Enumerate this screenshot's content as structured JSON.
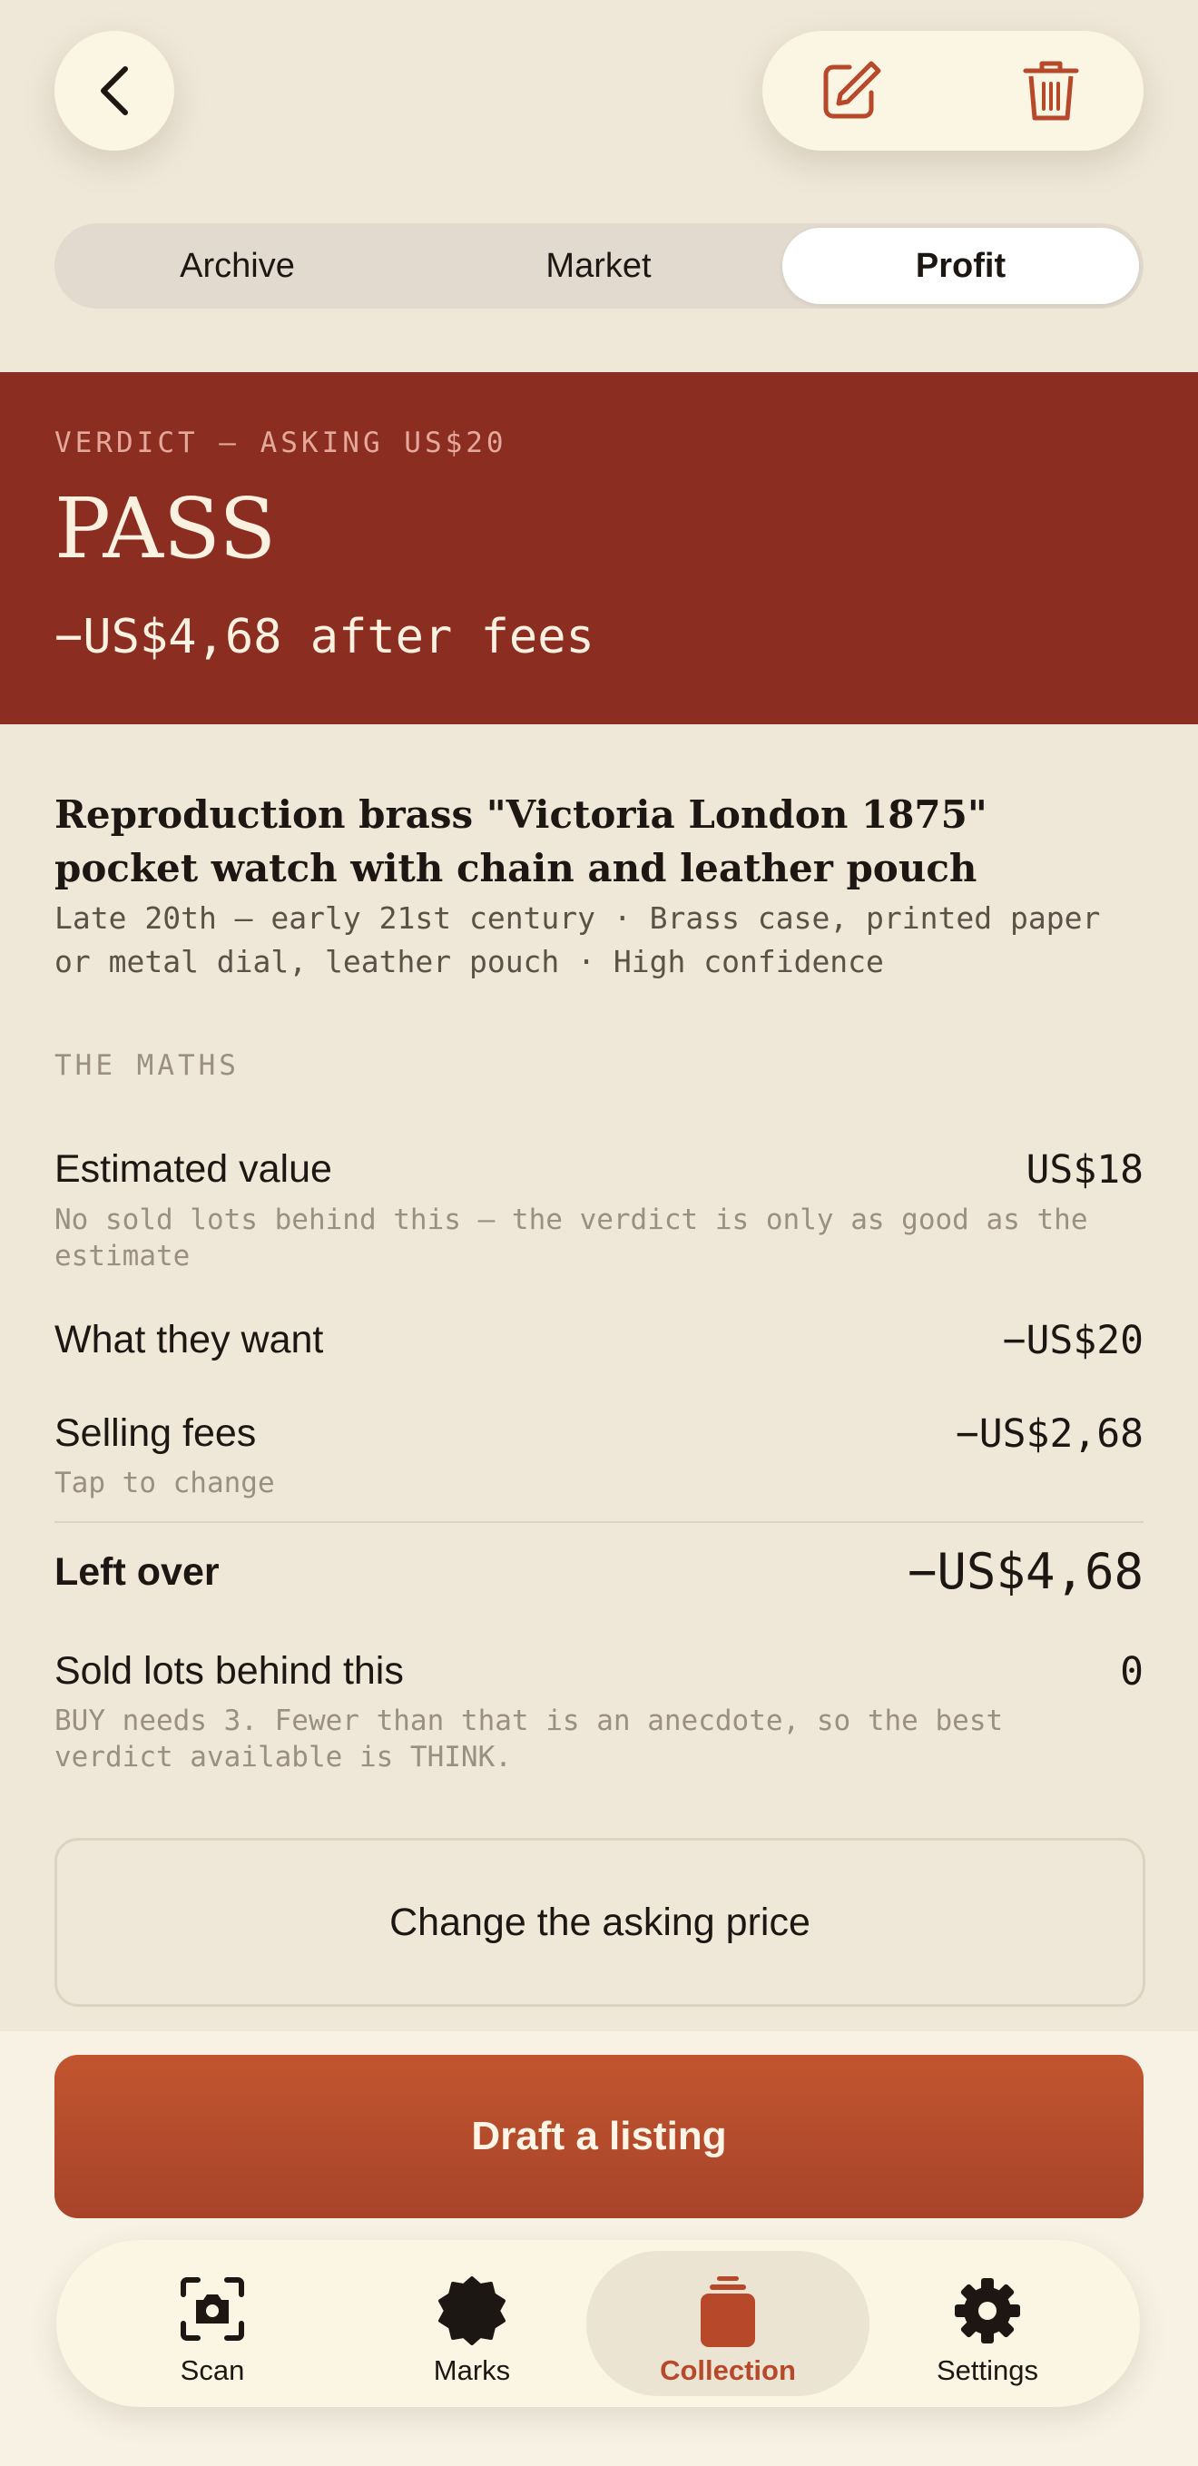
{
  "tabs": [
    "Archive",
    "Market",
    "Profit"
  ],
  "active_tab": "Profit",
  "verdict": {
    "label": "VERDICT — ASKING US$20",
    "word": "PASS",
    "sub": "−US$4,68 after fees"
  },
  "item": {
    "title": "Reproduction brass \"Victoria London 1875\" pocket watch with chain and leather pouch",
    "meta": "Late 20th — early 21st century · Brass case, printed paper or metal dial, leather pouch · High confidence"
  },
  "maths": {
    "heading": "THE MATHS",
    "rows": [
      {
        "label": "Estimated value",
        "value": "US$18",
        "note": "No sold lots behind this — the verdict is only as good as the estimate"
      },
      {
        "label": "What they want",
        "value": "−US$20",
        "note": ""
      },
      {
        "label": "Selling fees",
        "value": "−US$2,68",
        "note": "Tap to change"
      },
      {
        "label": "Left over",
        "value": "−US$4,68",
        "note": ""
      },
      {
        "label": "Sold lots behind this",
        "value": "0",
        "note": "BUY needs 3. Fewer than that is an anecdote, so the best verdict available is THINK."
      }
    ]
  },
  "buttons": {
    "change_price": "Change the asking price",
    "draft_listing": "Draft a listing"
  },
  "nav": [
    {
      "label": "Scan",
      "icon": "camera-scan-icon"
    },
    {
      "label": "Marks",
      "icon": "seal-icon"
    },
    {
      "label": "Collection",
      "icon": "stack-icon"
    },
    {
      "label": "Settings",
      "icon": "gear-icon"
    }
  ],
  "nav_active": "Collection",
  "colors": {
    "background": "#efe7d8",
    "verdict_bg": "#8b2d20",
    "accent": "#b8482a",
    "surface": "#fbf5e4"
  }
}
